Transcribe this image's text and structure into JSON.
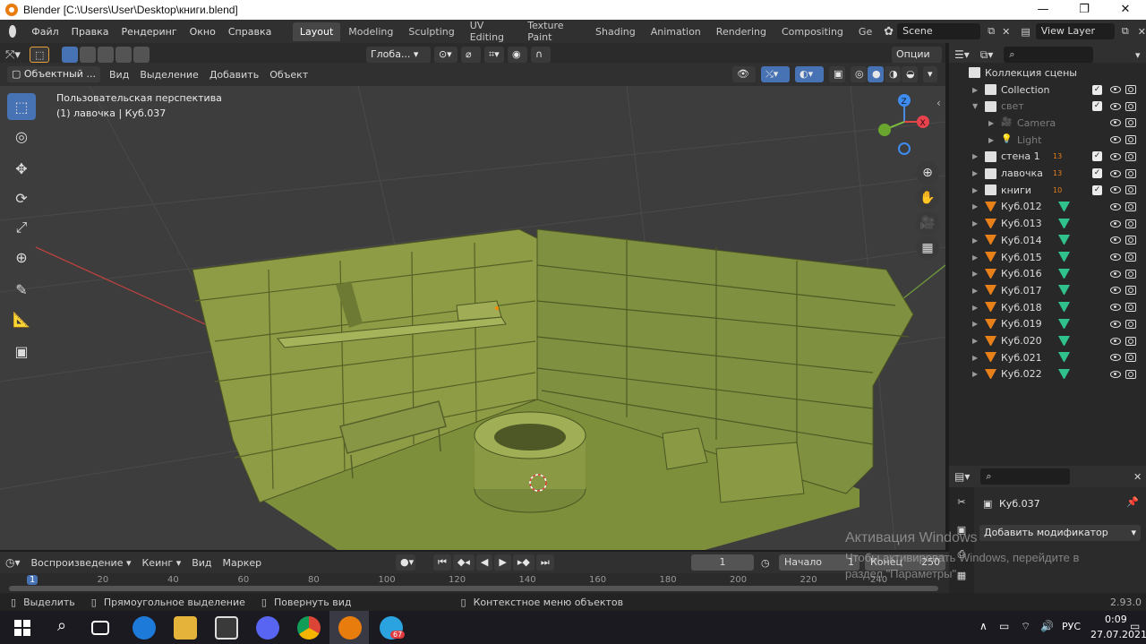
{
  "window": {
    "title": "Blender [C:\\Users\\User\\Desktop\\книги.blend]"
  },
  "menu": [
    "Файл",
    "Правка",
    "Рендеринг",
    "Окно",
    "Справка"
  ],
  "workspaces": [
    "Layout",
    "Modeling",
    "Sculpting",
    "UV Editing",
    "Texture Paint",
    "Shading",
    "Animation",
    "Rendering",
    "Compositing",
    "Ge"
  ],
  "scene": {
    "name": "Scene",
    "view_layer": "View Layer"
  },
  "viewport_header": {
    "transform_orientation": "Глоба...",
    "options": "Опции",
    "mode": "Объектный ...",
    "menus": [
      "Вид",
      "Выделение",
      "Добавить",
      "Объект"
    ]
  },
  "viewport": {
    "perspective_label": "Пользовательская перспектива",
    "object_label": "(1) лавочка | Куб.037"
  },
  "outliner": {
    "scene_collection": "Коллекция сцены",
    "items": [
      {
        "label": "Collection",
        "kind": "collection",
        "indent": 0
      },
      {
        "label": "свет",
        "kind": "collection",
        "indent": 0,
        "dim": true
      },
      {
        "label": "Camera",
        "kind": "camera",
        "indent": 1,
        "dim": true
      },
      {
        "label": "Light",
        "kind": "light",
        "indent": 1,
        "dim": true
      },
      {
        "label": "стена 1",
        "kind": "collection",
        "indent": 0,
        "badge": "13"
      },
      {
        "label": "лавочка",
        "kind": "collection",
        "indent": 0,
        "badge": "13"
      },
      {
        "label": "книги",
        "kind": "collection",
        "indent": 0,
        "badge": "10"
      },
      {
        "label": "Куб.012",
        "kind": "mesh",
        "indent": 0
      },
      {
        "label": "Куб.013",
        "kind": "mesh",
        "indent": 0
      },
      {
        "label": "Куб.014",
        "kind": "mesh",
        "indent": 0
      },
      {
        "label": "Куб.015",
        "kind": "mesh",
        "indent": 0
      },
      {
        "label": "Куб.016",
        "kind": "mesh",
        "indent": 0
      },
      {
        "label": "Куб.017",
        "kind": "mesh",
        "indent": 0
      },
      {
        "label": "Куб.018",
        "kind": "mesh",
        "indent": 0
      },
      {
        "label": "Куб.019",
        "kind": "mesh",
        "indent": 0
      },
      {
        "label": "Куб.020",
        "kind": "mesh",
        "indent": 0
      },
      {
        "label": "Куб.021",
        "kind": "mesh",
        "indent": 0
      },
      {
        "label": "Куб.022",
        "kind": "mesh",
        "indent": 0
      }
    ]
  },
  "properties": {
    "object_name": "Куб.037",
    "add_modifier": "Добавить модификатор"
  },
  "timeline": {
    "menus": [
      "Воспроизведение",
      "Кеинг",
      "Вид",
      "Маркер"
    ],
    "current_frame": "1",
    "start_label": "Начало",
    "start_value": "1",
    "end_label": "Конец",
    "end_value": "250",
    "ruler": [
      "1",
      "20",
      "40",
      "60",
      "80",
      "100",
      "120",
      "140",
      "160",
      "180",
      "200",
      "220",
      "240"
    ]
  },
  "statusbar": {
    "select": "Выделить",
    "box_select": "Прямоугольное выделение",
    "rotate_view": "Повернуть вид",
    "context_menu": "Контекстное меню объектов",
    "version": "2.93.0"
  },
  "watermark": {
    "title": "Активация Windows",
    "line1": "Чтобы активировать Windows, перейдите в",
    "line2": "раздел \"Параметры\"."
  },
  "taskbar": {
    "lang": "РУС",
    "time": "0:09",
    "date": "27.07.2021",
    "telegram_badge": "67"
  }
}
